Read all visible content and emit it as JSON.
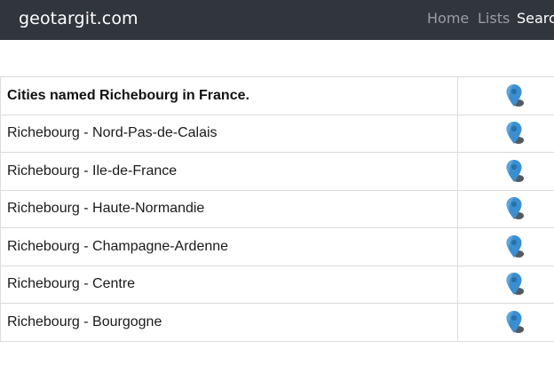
{
  "navbar": {
    "brand": "geotargit.com",
    "links": [
      {
        "label": "Home"
      },
      {
        "label": "Lists"
      },
      {
        "label": "Search"
      }
    ]
  },
  "table": {
    "header": "Cities named Richebourg in France.",
    "rows": [
      {
        "label": "Richebourg - Nord-Pas-de-Calais",
        "icon": "map-pin-icon"
      },
      {
        "label": "Richebourg - Ile-de-France",
        "icon": "map-pin-icon"
      },
      {
        "label": "Richebourg - Haute-Normandie",
        "icon": "map-pin-icon"
      },
      {
        "label": "Richebourg - Champagne-Ardenne",
        "icon": "map-pin-icon"
      },
      {
        "label": "Richebourg - Centre",
        "icon": "map-pin-icon"
      },
      {
        "label": "Richebourg - Bourgogne",
        "icon": "map-pin-icon"
      }
    ]
  },
  "colors": {
    "navbar_bg": "#31353c",
    "pin_blue": "#3b8fd0",
    "pin_shadow": "#555a60"
  }
}
